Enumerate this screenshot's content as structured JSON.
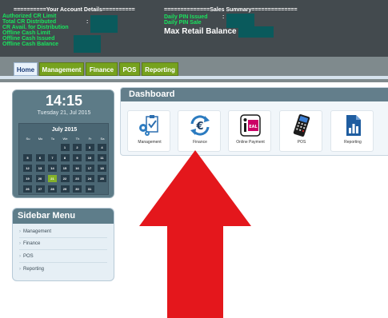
{
  "header": {
    "account_title": "==========Your Account Details==========",
    "account_lines": [
      "Authorized CR Limit",
      "Total CR Distributed",
      "CR Avail. for Distribution",
      "Offline Cash Limit",
      "Offline Cash Issued",
      "Offline Cash Balance"
    ],
    "account_colon": ":",
    "sales_title": "==============Sales Summary==============",
    "sales_lines": [
      "Daily PIN Issued",
      "Daily PIN Sale"
    ],
    "sales_colon": ":",
    "max_balance": "Max Retail Balance :"
  },
  "nav": {
    "tabs": [
      {
        "label": "Home",
        "active": true
      },
      {
        "label": "Management",
        "active": false
      },
      {
        "label": "Finance",
        "active": false
      },
      {
        "label": "POS",
        "active": false
      },
      {
        "label": "Reporting",
        "active": false
      }
    ]
  },
  "clock": {
    "time": "14:15",
    "date": "Tuesday 21, Jul 2015"
  },
  "calendar": {
    "title": "July 2015",
    "dow": [
      "Su",
      "Mo",
      "Tu",
      "We",
      "Th",
      "Fr",
      "Sa"
    ],
    "weeks": [
      [
        "",
        "",
        "",
        "1",
        "2",
        "3",
        "4"
      ],
      [
        "5",
        "6",
        "7",
        "8",
        "9",
        "10",
        "11"
      ],
      [
        "12",
        "13",
        "14",
        "15",
        "16",
        "17",
        "18"
      ],
      [
        "19",
        "20",
        "21",
        "22",
        "23",
        "24",
        "25"
      ],
      [
        "26",
        "27",
        "28",
        "29",
        "30",
        "31",
        ""
      ]
    ],
    "today": "21"
  },
  "sidebar": {
    "title": "Sidebar Menu",
    "items": [
      {
        "label": "Management"
      },
      {
        "label": "Finance"
      },
      {
        "label": "POS"
      },
      {
        "label": "Reporting"
      }
    ]
  },
  "dashboard": {
    "title": "Dashboard",
    "tiles": [
      {
        "label": "Management",
        "icon": "management-icon"
      },
      {
        "label": "Finance",
        "icon": "finance-icon"
      },
      {
        "label": "Online Payment",
        "icon": "ideal-icon"
      },
      {
        "label": "POS",
        "icon": "pos-terminal-icon"
      },
      {
        "label": "Reporting",
        "icon": "reporting-icon"
      }
    ]
  },
  "colors": {
    "header_bg": "#434a4e",
    "account_text": "#19e35e",
    "tab_green": "#76a21e",
    "panel_slate": "#5d7b87",
    "arrow_red": "#e4171c"
  }
}
